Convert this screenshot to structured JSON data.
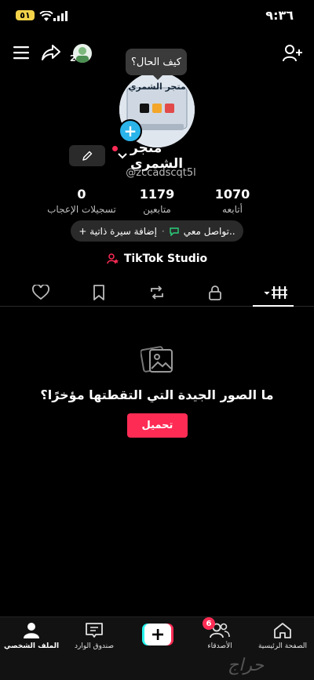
{
  "status_bar": {
    "time": "٩:٣٦",
    "battery": "٥١"
  },
  "header": {
    "friends_count": "2"
  },
  "profile": {
    "bubble_text": "كيف الحال؟",
    "avatar_caption": "متجر الشمري",
    "display_name": "متجر الشمري",
    "username": "@zccadscqt5l",
    "stats": [
      {
        "value": "1070",
        "label": "أتابعه"
      },
      {
        "value": "1179",
        "label": "متابعين"
      },
      {
        "value": "0",
        "label": "تسجيلات الإعجاب"
      }
    ],
    "bio_button": "+ إضافة سيرة ذاتية",
    "contact_text": "تواصل معي..",
    "studio_label": "TikTok Studio"
  },
  "empty_state": {
    "title": "ما الصور الجيدة التي التقطتها مؤخرًا؟",
    "upload_label": "تحميل"
  },
  "bottom_nav": {
    "home": "الصفحة الرئيسية",
    "friends": "الأصدقاء",
    "friends_badge": "6",
    "inbox": "صندوق الوارد",
    "profile": "الملف الشخصي"
  },
  "watermark": "حراج",
  "colors": {
    "accent": "#fe2c55",
    "cyan": "#25f4ee",
    "blue": "#2ab4ea",
    "battery": "#f4d34a"
  }
}
